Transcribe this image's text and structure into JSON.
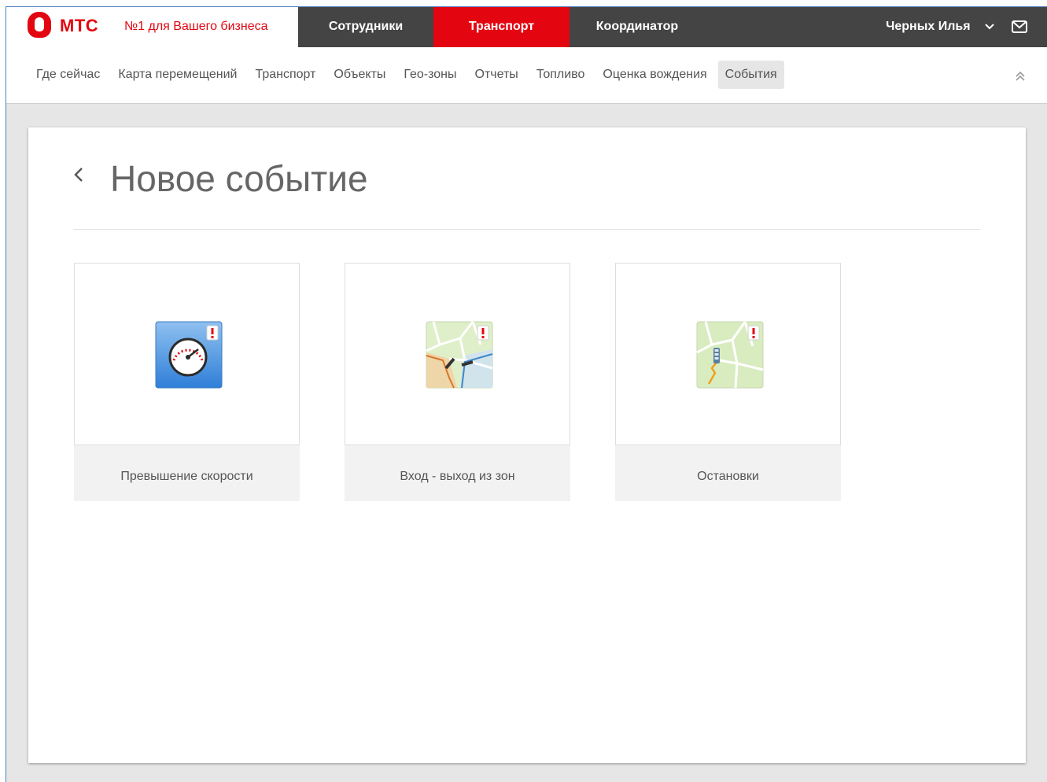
{
  "header": {
    "logo_text": "МТС",
    "slogan": "№1 для Вашего бизнеса",
    "tabs": [
      {
        "label": "Сотрудники",
        "active": false
      },
      {
        "label": "Транспорт",
        "active": true
      },
      {
        "label": "Координатор",
        "active": false
      }
    ],
    "user_name": "Черных Илья"
  },
  "subnav": {
    "items": [
      {
        "label": "Где сейчас",
        "active": false
      },
      {
        "label": "Карта перемещений",
        "active": false
      },
      {
        "label": "Транспорт",
        "active": false
      },
      {
        "label": "Объекты",
        "active": false
      },
      {
        "label": "Гео-зоны",
        "active": false
      },
      {
        "label": "Отчеты",
        "active": false
      },
      {
        "label": "Топливо",
        "active": false
      },
      {
        "label": "Оценка вождения",
        "active": false
      },
      {
        "label": "События",
        "active": true
      }
    ]
  },
  "main": {
    "title": "Новое событие",
    "event_types": [
      {
        "label": "Превышение скорости",
        "icon": "speedometer-icon"
      },
      {
        "label": "Вход - выход из зон",
        "icon": "zone-map-icon"
      },
      {
        "label": "Остановки",
        "icon": "stops-map-icon"
      }
    ]
  },
  "colors": {
    "brand_red": "#e30611",
    "topbar": "#444444",
    "page_bg": "#e6e6e6"
  }
}
